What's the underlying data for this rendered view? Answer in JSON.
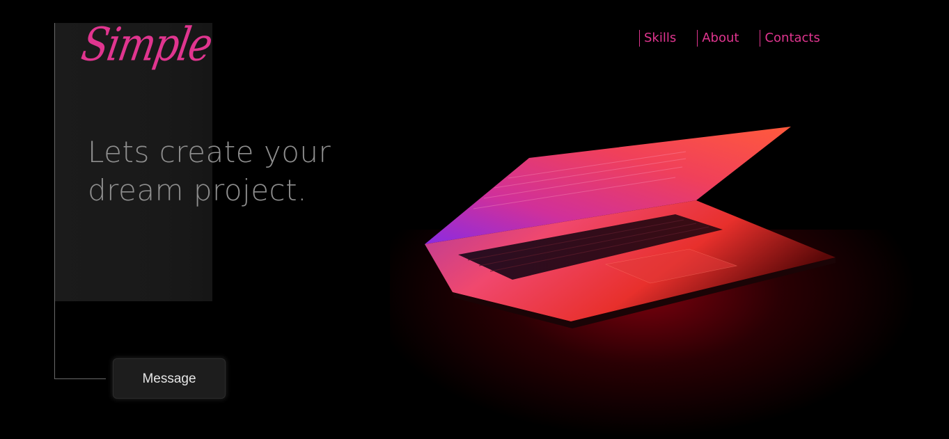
{
  "brand": {
    "logo_text": "Simple",
    "accent_color": "#e0358f"
  },
  "nav": {
    "items": [
      {
        "label": "Skills"
      },
      {
        "label": "About"
      },
      {
        "label": "Contacts"
      }
    ]
  },
  "hero": {
    "title_line1": "Lets create your",
    "title_line2": "dream project.",
    "cta_label": "Message"
  },
  "hero_image": {
    "subject": "laptop-icon"
  }
}
